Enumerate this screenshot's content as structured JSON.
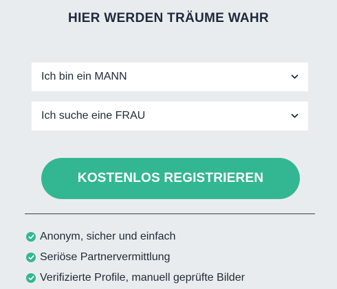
{
  "header": {
    "title": "HIER WERDEN TRÄUME WAHR"
  },
  "form": {
    "gender_select": {
      "selected": "Ich bin ein MANN",
      "icon": "chevron-down-icon"
    },
    "seeking_select": {
      "selected": "Ich suche eine FRAU",
      "icon": "chevron-down-icon"
    },
    "register_button_label": "KOSTENLOS REGISTRIEREN"
  },
  "features": {
    "icon": "check-circle-icon",
    "items": [
      "Anonym, sicher und einfach",
      "Seriöse Partnervermittlung",
      "Verifizierte Profile, manuell geprüfte Bilder"
    ]
  },
  "colors": {
    "background": "#e9ecef",
    "accent": "#33b792",
    "title_text": "#1e2a3a"
  }
}
